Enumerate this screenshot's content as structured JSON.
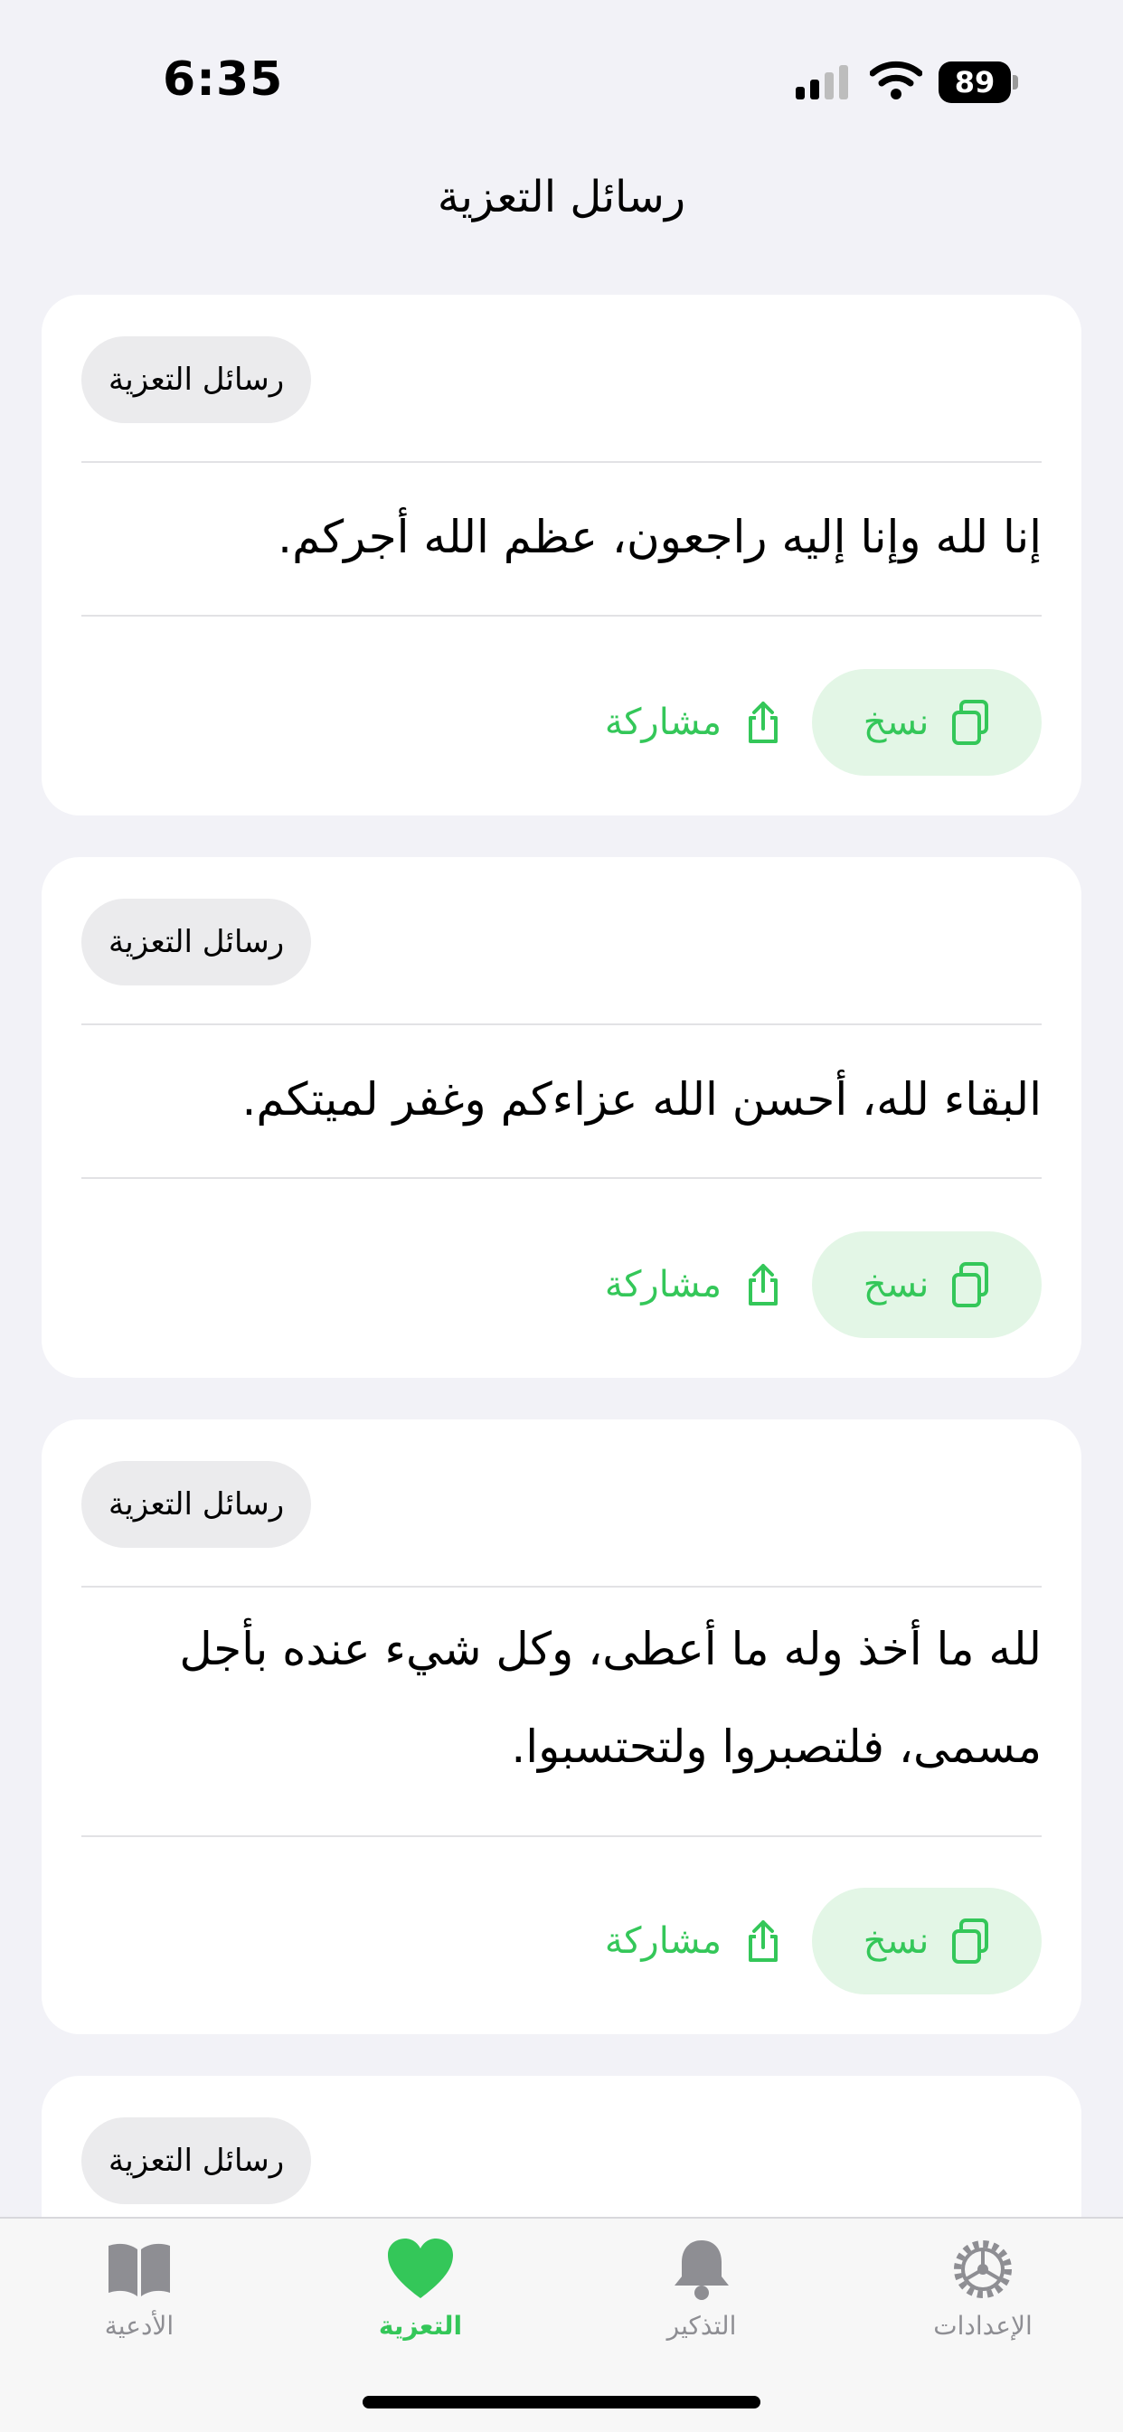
{
  "status_bar": {
    "time": "6:35",
    "battery": "89"
  },
  "nav": {
    "title": "رسائل التعزية"
  },
  "cards": [
    {
      "tag": "رسائل التعزية",
      "text": "إنا لله وإنا إليه راجعون، عظم الله أجركم.",
      "copy_label": "نسخ",
      "share_label": "مشاركة"
    },
    {
      "tag": "رسائل التعزية",
      "text": "البقاء لله، أحسن الله عزاءكم وغفر لميتكم.",
      "copy_label": "نسخ",
      "share_label": "مشاركة"
    },
    {
      "tag": "رسائل التعزية",
      "text": "لله ما أخذ وله ما أعطى، وكل شيء عنده بأجل مسمى، فلتصبروا ولتحتسبوا.",
      "copy_label": "نسخ",
      "share_label": "مشاركة"
    },
    {
      "tag": "رسائل التعزية"
    }
  ],
  "tabs": [
    {
      "label": "الأدعية",
      "icon": "book-icon",
      "active": false
    },
    {
      "label": "التعزية",
      "icon": "heart-icon",
      "active": true
    },
    {
      "label": "التذكير",
      "icon": "bell-icon",
      "active": false
    },
    {
      "label": "الإعدادات",
      "icon": "gear-icon",
      "active": false
    }
  ],
  "colors": {
    "accent": "#34c759",
    "accent_bg": "#e3f6e6",
    "background": "#f2f2f7",
    "tag_bg": "#ebebed"
  }
}
